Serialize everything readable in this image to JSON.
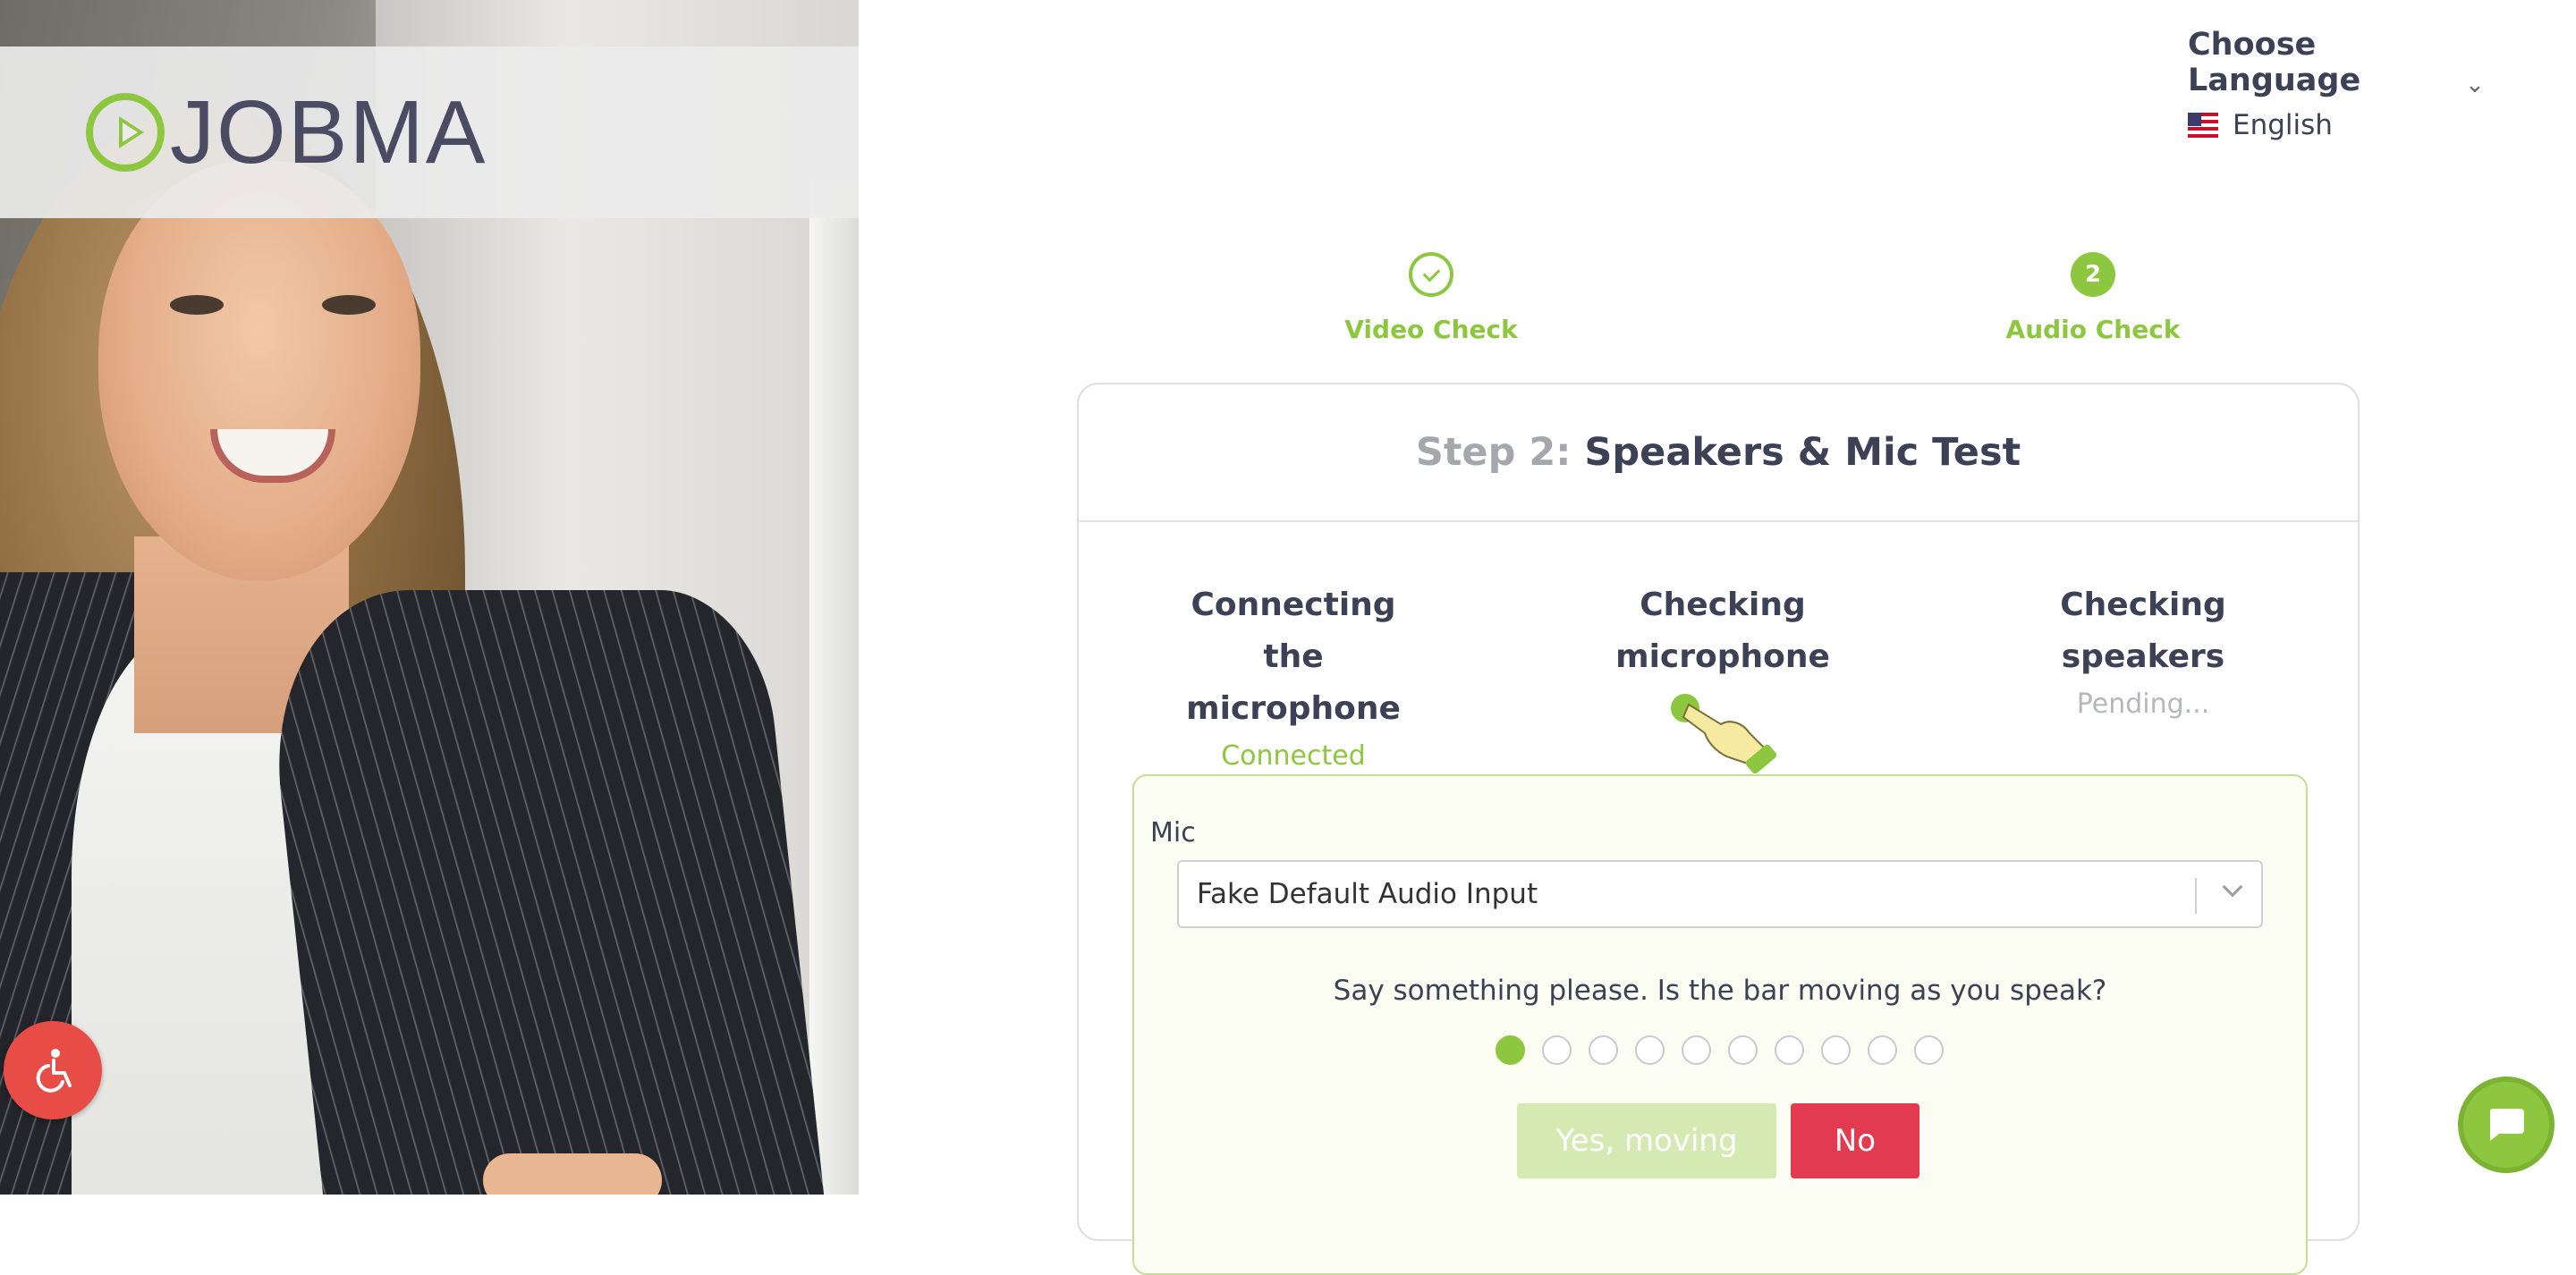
{
  "brand": {
    "logo_text": "JOBMA"
  },
  "language": {
    "title": "Choose Language",
    "selected": "English",
    "flag": "us-flag-icon"
  },
  "stepper": {
    "steps": [
      {
        "label": "Video Check",
        "state": "done"
      },
      {
        "number": "2",
        "label": "Audio Check",
        "state": "active"
      }
    ]
  },
  "card": {
    "title_prefix": "Step 2:",
    "title": "Speakers & Mic Test",
    "checks": [
      {
        "title": "Connecting the microphone",
        "status": "Connected"
      },
      {
        "title": "Checking microphone",
        "status_icon": "pointing-hand-icon"
      },
      {
        "title": "Checking speakers",
        "status": "Pending..."
      }
    ],
    "mic": {
      "label": "Mic",
      "selected": "Fake Default Audio Input",
      "prompt": "Say something please. Is the bar moving as you speak?",
      "level_dots_total": 10,
      "level_dots_active": 1,
      "yes_label": "Yes, moving",
      "no_label": "No"
    }
  },
  "colors": {
    "accent": "#8dc63f",
    "danger": "#e23a4e",
    "access": "#e84c47"
  }
}
